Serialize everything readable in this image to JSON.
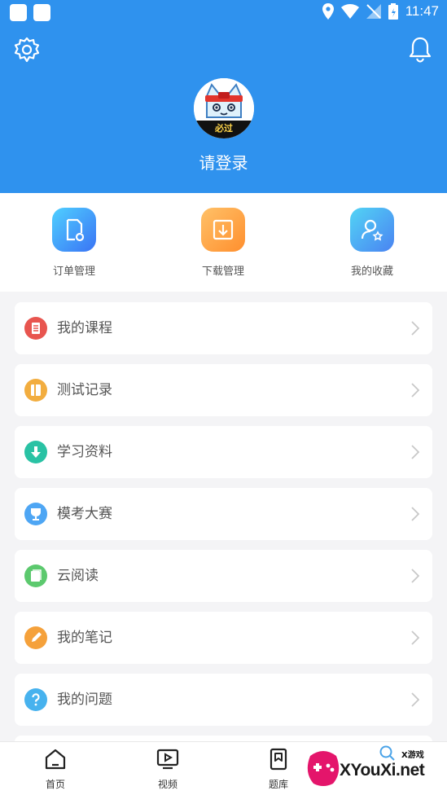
{
  "status_bar": {
    "time": "11:47"
  },
  "header": {
    "login_text": "请登录",
    "avatar_badge": "必过"
  },
  "quick_actions": [
    {
      "label": "订单管理",
      "icon": "order-settings-icon",
      "color_from": "#4fd0ff",
      "color_to": "#3a73f5"
    },
    {
      "label": "下载管理",
      "icon": "download-icon",
      "color_from": "#ffc168",
      "color_to": "#ff8f2e"
    },
    {
      "label": "我的收藏",
      "icon": "favorite-user-icon",
      "color_from": "#52d4f5",
      "color_to": "#4a83f2"
    }
  ],
  "menu": [
    {
      "label": "我的课程",
      "icon": "course-icon",
      "color": "#e8554f"
    },
    {
      "label": "测试记录",
      "icon": "test-record-icon",
      "color": "#f2ad3f"
    },
    {
      "label": "学习资料",
      "icon": "download-material-icon",
      "color": "#29c2a4"
    },
    {
      "label": "模考大赛",
      "icon": "trophy-icon",
      "color": "#4ea6f4"
    },
    {
      "label": "云阅读",
      "icon": "book-icon",
      "color": "#5cc96e"
    },
    {
      "label": "我的笔记",
      "icon": "pencil-icon",
      "color": "#f5a13b"
    },
    {
      "label": "我的问题",
      "icon": "question-icon",
      "color": "#47b2ee"
    }
  ],
  "bottom_nav": [
    {
      "label": "首页",
      "icon": "home-icon"
    },
    {
      "label": "视频",
      "icon": "video-icon"
    },
    {
      "label": "题库",
      "icon": "question-bank-icon"
    }
  ],
  "watermark": {
    "text": "XYouXi.net",
    "small": "X游戏"
  }
}
